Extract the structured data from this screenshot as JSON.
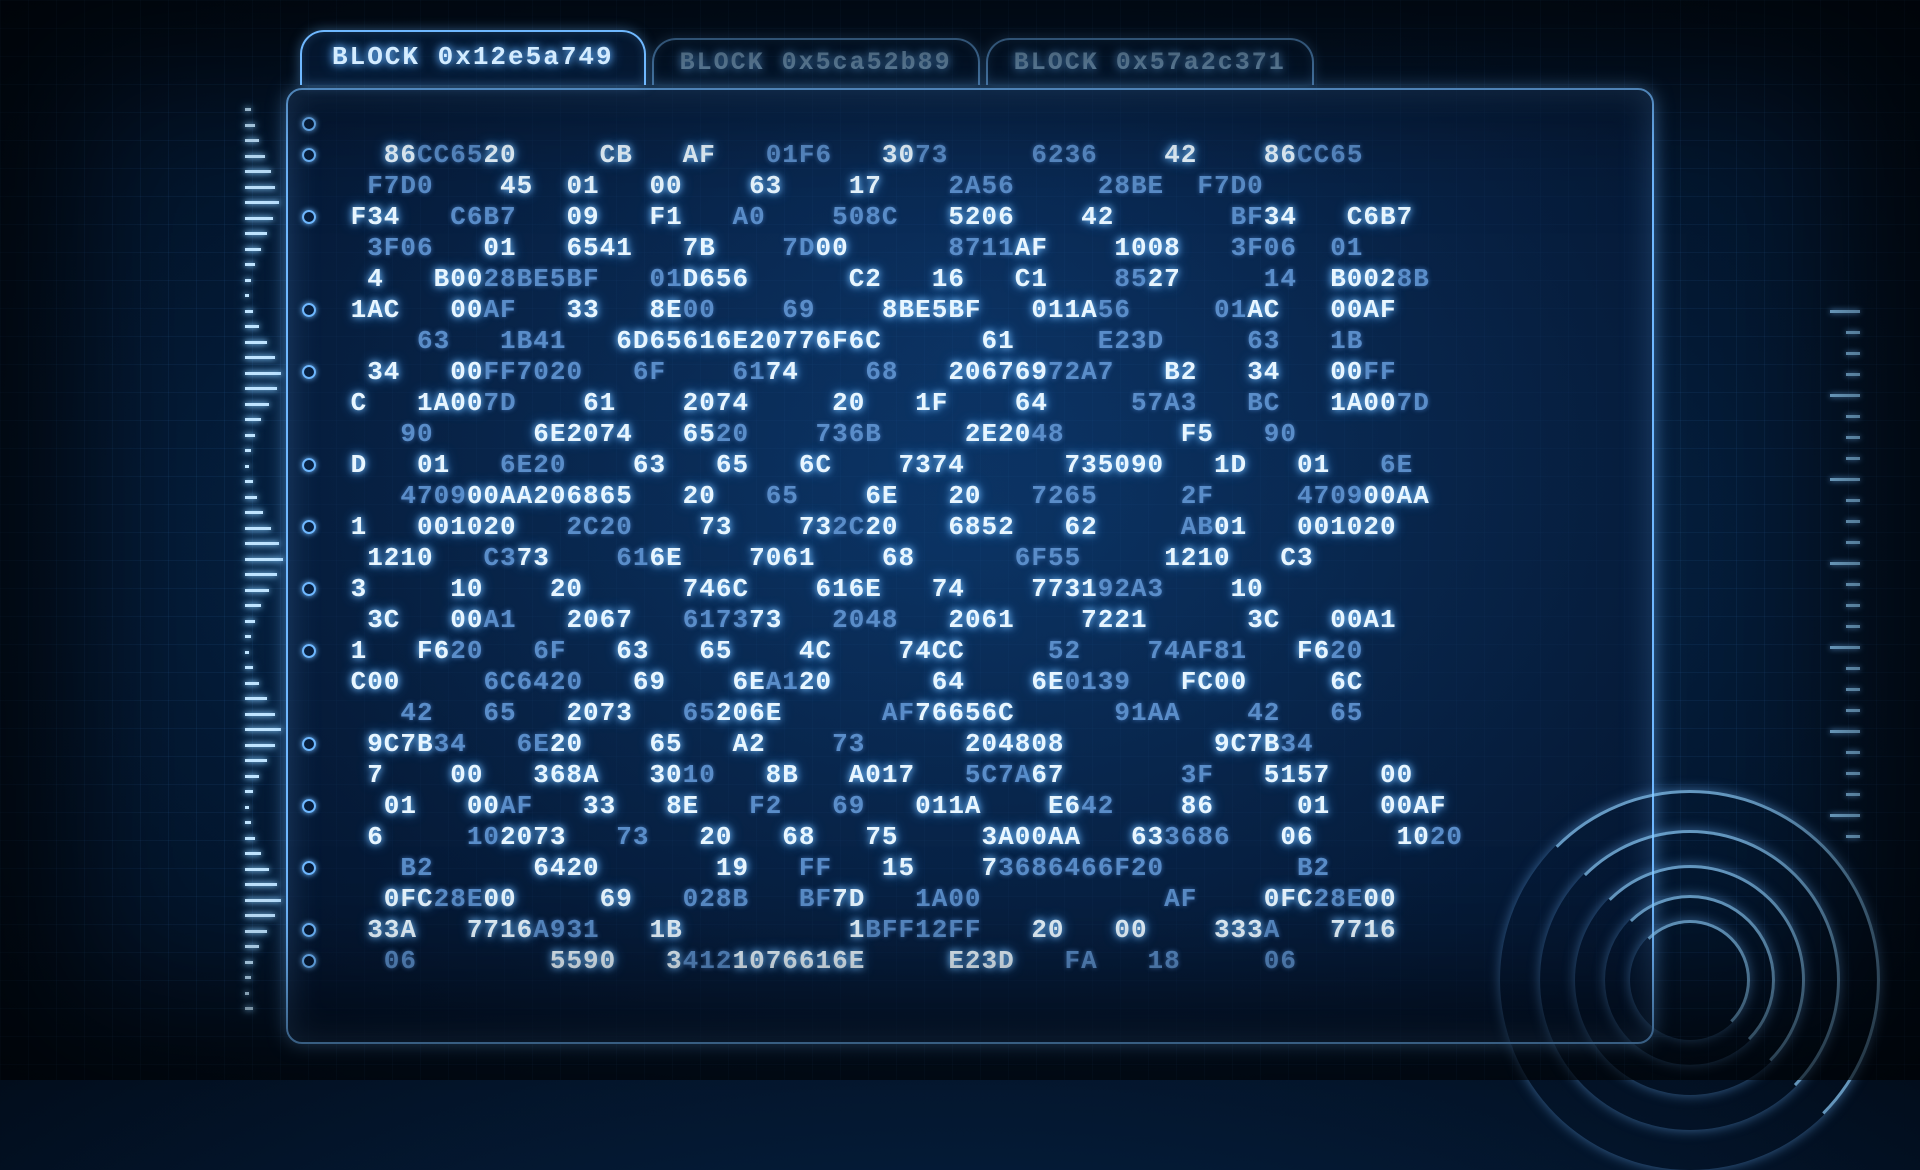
{
  "tabs": [
    {
      "label": "BLOCK 0x12e5a749",
      "active": true
    },
    {
      "label": "BLOCK 0x5ca52b89",
      "active": false
    },
    {
      "label": "BLOCK 0x57a2c371",
      "active": false
    }
  ],
  "lines": [
    {
      "bullet": true,
      "segs": [
        [
          "",
          false
        ]
      ]
    },
    {
      "bullet": true,
      "segs": [
        [
          "   86",
          false
        ],
        [
          "CC65",
          true
        ],
        [
          "20     CB",
          false
        ],
        [
          "   AF   ",
          false
        ],
        [
          "01F6",
          true
        ],
        [
          "   30",
          false
        ],
        [
          "73     ",
          true
        ],
        [
          "6236",
          true
        ],
        [
          "    42    86",
          false
        ],
        [
          "CC65",
          true
        ]
      ]
    },
    {
      "bullet": false,
      "segs": [
        [
          "  F7D0",
          true
        ],
        [
          "    45  01   00    63    17    ",
          false
        ],
        [
          "2A56   ",
          true
        ],
        [
          "  28BE  F7D0",
          true
        ],
        [
          "",
          false
        ]
      ]
    },
    {
      "bullet": true,
      "segs": [
        [
          " F34   ",
          false
        ],
        [
          "C6B7",
          true
        ],
        [
          "   09   F1   ",
          false
        ],
        [
          "A0    508C",
          true
        ],
        [
          "   5206    42       ",
          false
        ],
        [
          "BF",
          true
        ],
        [
          "34   C6B7",
          false
        ]
      ]
    },
    {
      "bullet": false,
      "segs": [
        [
          "  3F06",
          true
        ],
        [
          "   01   6541   7B    ",
          false
        ],
        [
          "7D",
          true
        ],
        [
          "00      ",
          false
        ],
        [
          "8711",
          true
        ],
        [
          "AF    1008   ",
          false
        ],
        [
          "3F06  01",
          true
        ]
      ]
    },
    {
      "bullet": false,
      "segs": [
        [
          "  4   B00",
          false
        ],
        [
          "28BE5BF   01",
          true
        ],
        [
          "D656      C2   16   C1    ",
          false
        ],
        [
          "85",
          true
        ],
        [
          "27     ",
          false
        ],
        [
          "14",
          true
        ],
        [
          "  B002",
          false
        ],
        [
          "8B",
          true
        ]
      ]
    },
    {
      "bullet": true,
      "segs": [
        [
          " 1AC   00",
          false
        ],
        [
          "AF",
          true
        ],
        [
          "   33   8E",
          false
        ],
        [
          "00    69    ",
          true
        ],
        [
          "8BE5BF   011A",
          false
        ],
        [
          "56     01",
          true
        ],
        [
          "AC   00AF",
          false
        ]
      ]
    },
    {
      "bullet": false,
      "segs": [
        [
          "     63   1B41",
          true
        ],
        [
          "   6D65616E20776F6C      61     ",
          false
        ],
        [
          "E23D     63   1B",
          true
        ]
      ]
    },
    {
      "bullet": true,
      "segs": [
        [
          "  34   00",
          false
        ],
        [
          "FF7020   6F    61",
          true
        ],
        [
          "74    ",
          false
        ],
        [
          "68   ",
          true
        ],
        [
          "206769",
          false
        ],
        [
          "72A7",
          true
        ],
        [
          "   B2   34   00",
          false
        ],
        [
          "FF",
          true
        ]
      ]
    },
    {
      "bullet": false,
      "segs": [
        [
          " C   1A00",
          false
        ],
        [
          "7D",
          true
        ],
        [
          "    61    2074     20   1F    64     ",
          false
        ],
        [
          "57A3   BC",
          true
        ],
        [
          "   1A00",
          false
        ],
        [
          "7D",
          true
        ]
      ]
    },
    {
      "bullet": false,
      "segs": [
        [
          "    90      ",
          true
        ],
        [
          "6E2074   65",
          false
        ],
        [
          "20    736B     ",
          true
        ],
        [
          "2E20",
          false
        ],
        [
          "48       ",
          true
        ],
        [
          "F5   ",
          false
        ],
        [
          "90",
          true
        ]
      ]
    },
    {
      "bullet": true,
      "segs": [
        [
          " D   01   ",
          false
        ],
        [
          "6E20",
          true
        ],
        [
          "    63   65   6C    7374      735090   1D   01   ",
          false
        ],
        [
          "6E",
          true
        ]
      ]
    },
    {
      "bullet": false,
      "segs": [
        [
          "    4709",
          true
        ],
        [
          "00AA206865   20   ",
          false
        ],
        [
          "65    ",
          true
        ],
        [
          "6E   20   ",
          false
        ],
        [
          "7265     2F     4709",
          true
        ],
        [
          "00AA",
          false
        ]
      ]
    },
    {
      "bullet": true,
      "segs": [
        [
          " 1   001020   ",
          false
        ],
        [
          "2C20",
          true
        ],
        [
          "    73    73",
          false
        ],
        [
          "2C",
          true
        ],
        [
          "20   6852   62     ",
          false
        ],
        [
          "AB",
          true
        ],
        [
          "01   001020",
          false
        ]
      ]
    },
    {
      "bullet": false,
      "segs": [
        [
          "  1210   ",
          false
        ],
        [
          "C3",
          true
        ],
        [
          "73    ",
          false
        ],
        [
          "61",
          true
        ],
        [
          "6E    7061    68      ",
          false
        ],
        [
          "6F55     ",
          true
        ],
        [
          "1210   C3",
          false
        ]
      ]
    },
    {
      "bullet": true,
      "segs": [
        [
          " 3     10    20      746C    616E   74    7731",
          false
        ],
        [
          "92A3",
          true
        ],
        [
          "    10",
          false
        ]
      ]
    },
    {
      "bullet": false,
      "segs": [
        [
          "  3C   00",
          false
        ],
        [
          "A1",
          true
        ],
        [
          "   2067   ",
          false
        ],
        [
          "6173",
          true
        ],
        [
          "73   ",
          false
        ],
        [
          "2048",
          true
        ],
        [
          "   2061    7221      3C   00A1",
          false
        ]
      ]
    },
    {
      "bullet": true,
      "segs": [
        [
          " 1   F6",
          false
        ],
        [
          "20   6F",
          true
        ],
        [
          "   63   65    4C    74CC     ",
          false
        ],
        [
          "52    74AF81",
          true
        ],
        [
          "   F6",
          false
        ],
        [
          "20",
          true
        ]
      ]
    },
    {
      "bullet": false,
      "segs": [
        [
          " C00     ",
          false
        ],
        [
          "6C6420",
          true
        ],
        [
          "   69    6E",
          false
        ],
        [
          "A1",
          true
        ],
        [
          "20      64    6E",
          false
        ],
        [
          "0139   ",
          true
        ],
        [
          "FC00     6C",
          false
        ]
      ]
    },
    {
      "bullet": false,
      "segs": [
        [
          "    ",
          false
        ],
        [
          "42   65   ",
          true
        ],
        [
          "2073   ",
          false
        ],
        [
          "65",
          true
        ],
        [
          "206E      ",
          false
        ],
        [
          "AF",
          true
        ],
        [
          "76656C      ",
          false
        ],
        [
          "91AA    42   65",
          true
        ]
      ]
    },
    {
      "bullet": true,
      "segs": [
        [
          "  9C7B",
          false
        ],
        [
          "34   6E",
          true
        ],
        [
          "20    65   A2    ",
          false
        ],
        [
          "73      ",
          true
        ],
        [
          "204808         9C7B",
          false
        ],
        [
          "34",
          true
        ]
      ]
    },
    {
      "bullet": false,
      "segs": [
        [
          "  7    00   368A   30",
          false
        ],
        [
          "10   ",
          true
        ],
        [
          "8B   A017   ",
          false
        ],
        [
          "5C7A",
          true
        ],
        [
          "67       ",
          false
        ],
        [
          "3F",
          true
        ],
        [
          "   5157   00",
          false
        ]
      ]
    },
    {
      "bullet": true,
      "segs": [
        [
          "   01   00",
          false
        ],
        [
          "AF",
          true
        ],
        [
          "   33   8E   ",
          false
        ],
        [
          "F2   69   ",
          true
        ],
        [
          "011A    E6",
          false
        ],
        [
          "42    ",
          true
        ],
        [
          "86     01   00AF",
          false
        ]
      ]
    },
    {
      "bullet": false,
      "segs": [
        [
          "  6     ",
          false
        ],
        [
          "10",
          true
        ],
        [
          "2073   ",
          false
        ],
        [
          "73",
          true
        ],
        [
          "   20   68   75     3A00AA   63",
          false
        ],
        [
          "3686   ",
          true
        ],
        [
          "06     10",
          false
        ],
        [
          "20",
          true
        ]
      ]
    },
    {
      "bullet": true,
      "segs": [
        [
          "    B2      ",
          true
        ],
        [
          "6420       19   ",
          false
        ],
        [
          "FF   ",
          true
        ],
        [
          "15    7",
          false
        ],
        [
          "3686466F20        B2",
          true
        ]
      ]
    },
    {
      "bullet": false,
      "segs": [
        [
          "   0FC",
          false
        ],
        [
          "28E",
          true
        ],
        [
          "00     69   ",
          false
        ],
        [
          "028B   BF",
          true
        ],
        [
          "7D   ",
          false
        ],
        [
          "1A00           AF",
          true
        ],
        [
          "    0FC",
          false
        ],
        [
          "28E",
          true
        ],
        [
          "00",
          false
        ]
      ]
    },
    {
      "bullet": true,
      "segs": [
        [
          "  33A   7716",
          false
        ],
        [
          "A931",
          true
        ],
        [
          "   1B          1",
          false
        ],
        [
          "BFF12FF",
          true
        ],
        [
          "   20   00    333",
          false
        ],
        [
          "A",
          true
        ],
        [
          "   7716",
          false
        ]
      ]
    },
    {
      "bullet": true,
      "segs": [
        [
          "   06        ",
          true
        ],
        [
          "5590   3",
          false
        ],
        [
          "412",
          true
        ],
        [
          "1076616E     E23D   ",
          false
        ],
        [
          "FA   18     06",
          true
        ]
      ]
    }
  ],
  "waveform": [
    6,
    10,
    14,
    20,
    26,
    30,
    34,
    28,
    22,
    16,
    10,
    6,
    4,
    8,
    14,
    22,
    30,
    36,
    32,
    24,
    16,
    10,
    6,
    4,
    8,
    12,
    18,
    26,
    34,
    38,
    32,
    24,
    16,
    10,
    6,
    4,
    8,
    14,
    22,
    30,
    36,
    30,
    22,
    14,
    8,
    4,
    6,
    10,
    16,
    24,
    32,
    36,
    30,
    22,
    14,
    8,
    6,
    4,
    8
  ],
  "rings": [
    380,
    300,
    230,
    170,
    120
  ]
}
